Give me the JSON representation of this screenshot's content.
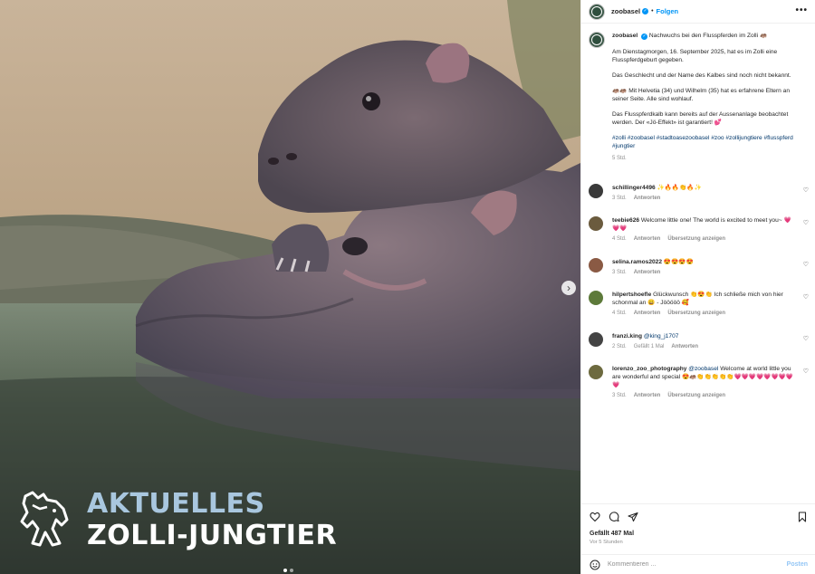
{
  "post": {
    "username": "zoobasel",
    "verified_icon": "verified-badge-icon",
    "separator": "•",
    "follow_label": "Folgen",
    "more_icon": "more-horizontal-icon",
    "more_label": "•••"
  },
  "photo": {
    "overlay_line1": "AKTUELLES",
    "overlay_line2": "ZOLLI-JUNGTIER",
    "next_label": "›",
    "carousel_count": 2,
    "carousel_active": 0
  },
  "caption": {
    "username": "zoobasel",
    "headline": "Nachwuchs bei den Flusspferden im Zolli 🦛",
    "p1": "Am Dienstagmorgen, 16. September 2025, hat es im Zolli eine Flusspferdgeburt gegeben.",
    "p2": "Das Geschlecht und der Name des Kalbes sind noch nicht bekannt.",
    "p3": "🦛🦛 Mit Helvetia (34) und Wilhelm (35) hat es erfahrene Eltern an seiner Seite. Alle sind wohlauf.",
    "p4": "Das Flusspferdkalb kann bereits auf der Aussenanlage beobachtet werden. Der «Jö-Effekt» ist garantiert! 💕",
    "hashtags": "#zolli #zoobasel #stadtoasezoobasel #zoo #zollijungtiere #flusspferd #jungtier",
    "time": "5 Std."
  },
  "comments": [
    {
      "user": "schillinger4496",
      "text": "✨🔥🔥👏🔥✨",
      "time": "3 Std.",
      "likes": "",
      "reply": "Antworten",
      "translate": "",
      "avatar_color": "#3a3a3a"
    },
    {
      "user": "teebie626",
      "text": "Welcome little one! The world is excited to meet you~ 💗💗💗",
      "time": "4 Std.",
      "likes": "",
      "reply": "Antworten",
      "translate": "Übersetzung anzeigen",
      "avatar_color": "#6b5b3e"
    },
    {
      "user": "selina.ramos2022",
      "text": "😍😍😍😍",
      "time": "3 Std.",
      "likes": "",
      "reply": "Antworten",
      "translate": "",
      "avatar_color": "#8a5a44"
    },
    {
      "user": "hilpertshoefle",
      "text": "Glückwunsch 👏😍👏 Ich schließe mich von hier schonmal an 😄 - Jööööö 🥰",
      "time": "4 Std.",
      "likes": "",
      "reply": "Antworten",
      "translate": "Übersetzung anzeigen",
      "avatar_color": "#5d7a3a"
    },
    {
      "user": "franzi.king",
      "mention": "@king_j1707",
      "text": "",
      "time": "2 Std.",
      "likes": "Gefällt 1 Mal",
      "reply": "Antworten",
      "translate": "",
      "avatar_color": "#444444"
    },
    {
      "user": "lorenzo_zoo_photography",
      "mention": "@zoobasel",
      "text": "Welcome at world little you are wonderful and special 😍🦛👏👏👏👏👏💗💗💗💗💗💗💗💗💗",
      "time": "3 Std.",
      "likes": "",
      "reply": "Antworten",
      "translate": "Übersetzung anzeigen",
      "avatar_color": "#6d6a3f"
    }
  ],
  "actions": {
    "like_icon": "heart-icon",
    "comment_icon": "comment-icon",
    "share_icon": "share-icon",
    "save_icon": "bookmark-icon",
    "likes_text": "Gefällt 487 Mal",
    "posted_ago": "Vor 5 Stunden"
  },
  "add_comment": {
    "emoji_icon": "emoji-icon",
    "placeholder": "Kommentieren ...",
    "post_label": "Posten"
  },
  "colors": {
    "link_blue": "#0095f6",
    "hashtag_blue": "#00376b",
    "overlay_light_blue": "#a9c7df"
  }
}
